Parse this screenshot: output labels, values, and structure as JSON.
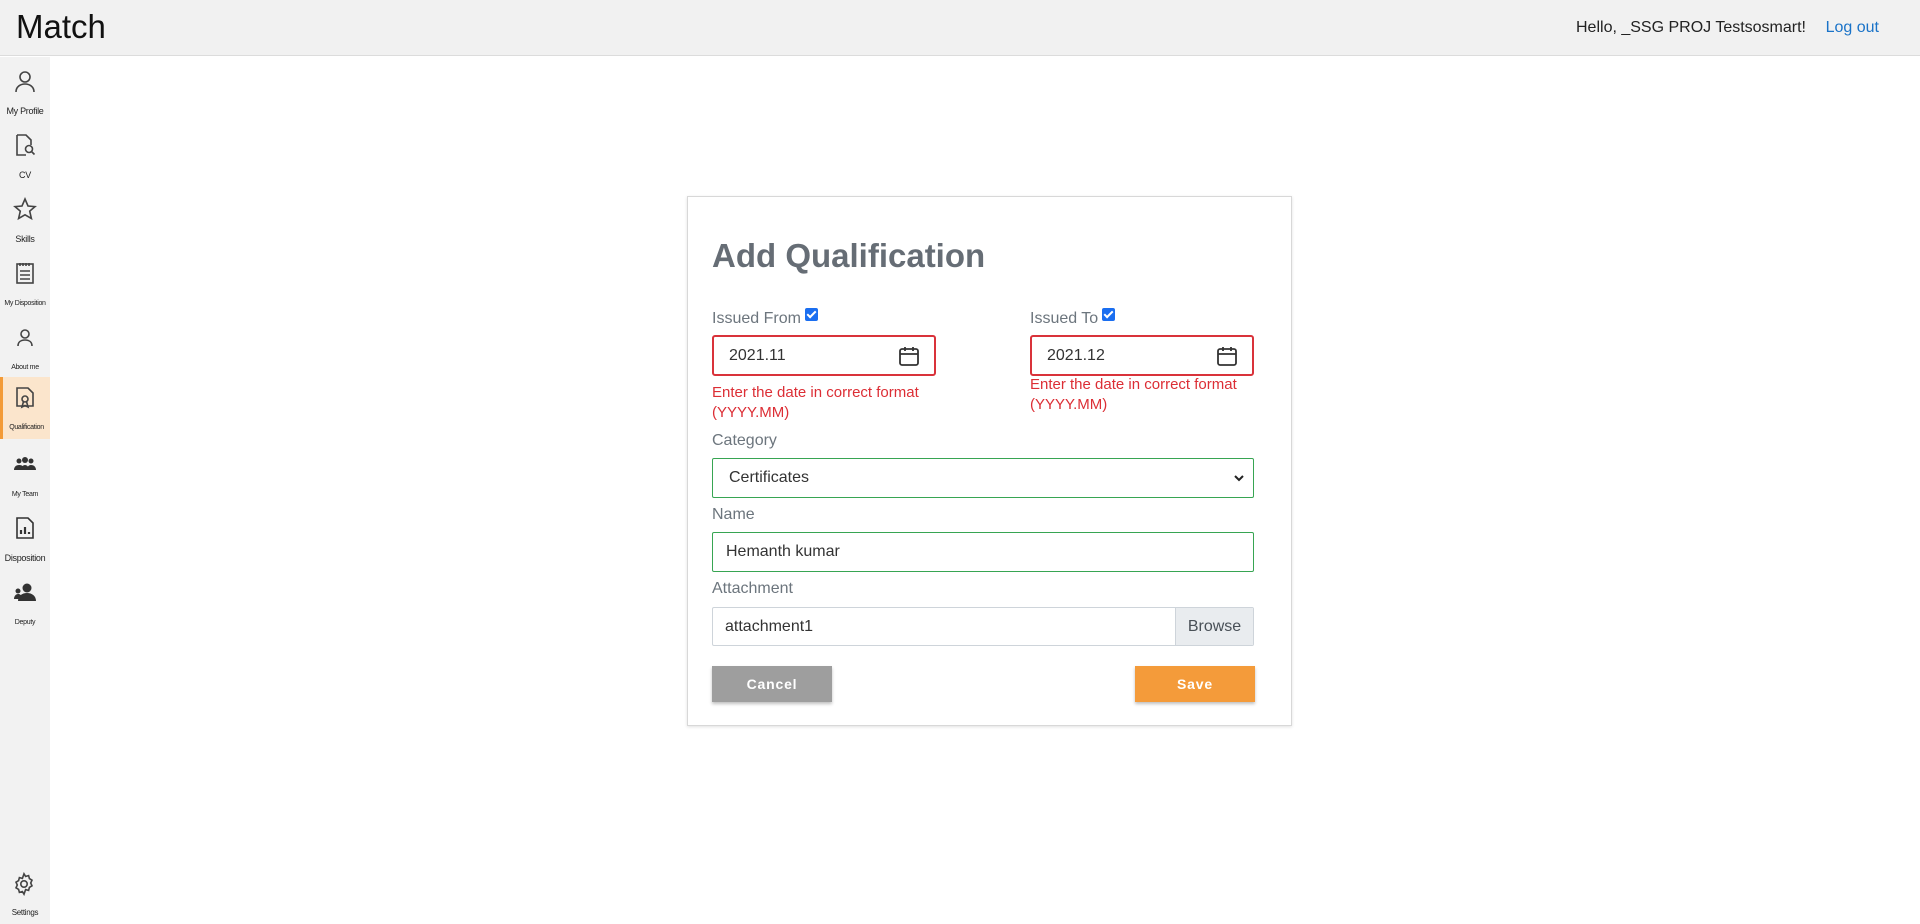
{
  "header": {
    "brand": "Match",
    "greeting": "Hello, _SSG PROJ Testsosmart!",
    "logout": "Log out"
  },
  "sidebar": {
    "items": [
      {
        "label": "My Profile",
        "icon": "person-icon"
      },
      {
        "label": "CV",
        "icon": "cv-search-icon"
      },
      {
        "label": "Skills",
        "icon": "star-icon"
      },
      {
        "label": "My Disposition",
        "icon": "notepad-icon"
      },
      {
        "label": "About me",
        "icon": "person-small-icon"
      },
      {
        "label": "Qualification",
        "icon": "certificate-icon"
      },
      {
        "label": "My Team",
        "icon": "team-icon"
      },
      {
        "label": "Disposition",
        "icon": "report-icon"
      },
      {
        "label": "Deputy",
        "icon": "deputy-icon"
      }
    ],
    "active": "Qualification",
    "settings_label": "Settings"
  },
  "form": {
    "title": "Add Qualification",
    "issued_from": {
      "label": "Issued From",
      "checked": true,
      "value": "2021.11",
      "error": "Enter the date in correct format (YYYY.MM)"
    },
    "issued_to": {
      "label": "Issued To",
      "checked": true,
      "value": "2021.12",
      "error": "Enter the date in correct format (YYYY.MM)"
    },
    "category": {
      "label": "Category",
      "value": "Certificates"
    },
    "name": {
      "label": "Name",
      "value": "Hemanth kumar"
    },
    "attachment": {
      "label": "Attachment",
      "value": "attachment1",
      "browse": "Browse"
    },
    "cancel": "Cancel",
    "save": "Save"
  },
  "colors": {
    "accent": "#f49b3a",
    "error": "#dc2e35",
    "valid": "#37a552",
    "link": "#1a73c8"
  }
}
